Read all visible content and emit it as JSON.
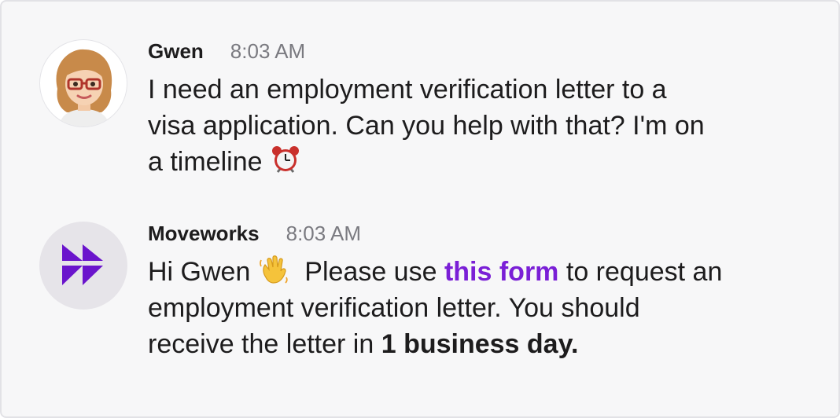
{
  "messages": [
    {
      "sender": "Gwen",
      "time": "8:03 AM",
      "text_line1": "I need an employment verification letter to a",
      "text_line2": "visa application. Can you help with that? I'm on",
      "text_line3": "a timeline",
      "emoji": "alarm-clock-icon"
    },
    {
      "sender": "Moveworks",
      "time": "8:03 AM",
      "text_greeting": "Hi Gwen",
      "emoji": "waving-hand-icon",
      "text_before_link": "Please use",
      "link_text": "this form",
      "text_after_link": "to request an",
      "text_line2": "employment verification letter. You should",
      "text_line3_prefix": "receive the letter in",
      "text_line3_bold": "1 business day."
    }
  ],
  "colors": {
    "link": "#7a1fd6",
    "logo": "#6a14cc",
    "background": "#f7f7f8"
  }
}
